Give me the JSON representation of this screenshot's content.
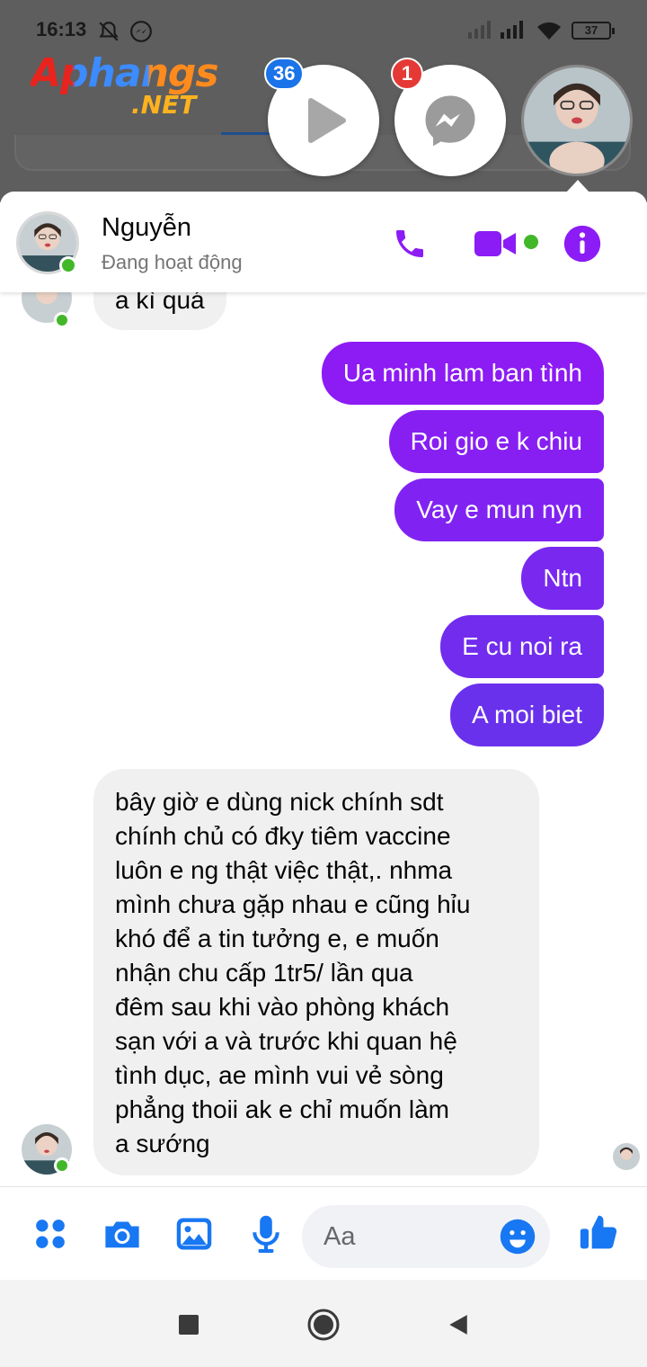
{
  "status_bar": {
    "time": "16:13",
    "battery": "37",
    "icons": [
      "bell-off-icon",
      "messenger-icon",
      "signal-icon",
      "signal-icon",
      "wifi-icon",
      "battery-icon"
    ]
  },
  "watermark": {
    "text": "Aphangs",
    "suffix": ".NET"
  },
  "chat_heads": {
    "video_badge": "36",
    "messenger_badge": "1"
  },
  "header": {
    "contact_name": "Nguyễn",
    "status": "Đang hoạt động",
    "icons": [
      "phone-icon",
      "video-call-icon",
      "info-icon"
    ]
  },
  "messages": {
    "partial_incoming": "a kì quá",
    "outgoing": [
      "Ua minh lam ban tình",
      "Roi gio e k chiu",
      "Vay e mun nyn",
      "Ntn",
      "E cu noi ra",
      "A moi biet"
    ],
    "incoming_lines": [
      "bây giờ e dùng nick chính sdt",
      "chính chủ có đky tiêm vaccine",
      "luôn e ng thật việc thật,. nhma",
      "mình chưa gặp nhau e cũng hỉu",
      "khó để a tin tưởng e, e muốn",
      "nhận chu cấp 1tr5/ lần qua",
      "đêm sau khi vào phòng khách",
      "sạn với a và trước khi quan hệ",
      "tình dục, ae mình vui vẻ sòng",
      "phẳng thoii ak e chỉ muốn làm",
      "a sướng"
    ]
  },
  "composer": {
    "placeholder": "Aa",
    "icons": [
      "apps-icon",
      "camera-icon",
      "gallery-icon",
      "microphone-icon",
      "emoji-icon",
      "thumbs-up-icon"
    ]
  },
  "colors": {
    "accent": "#8b1cf5",
    "accent_blue": "#1877f2",
    "online": "#42b72a",
    "badge_red": "#e53935",
    "badge_blue": "#1a73e8"
  }
}
